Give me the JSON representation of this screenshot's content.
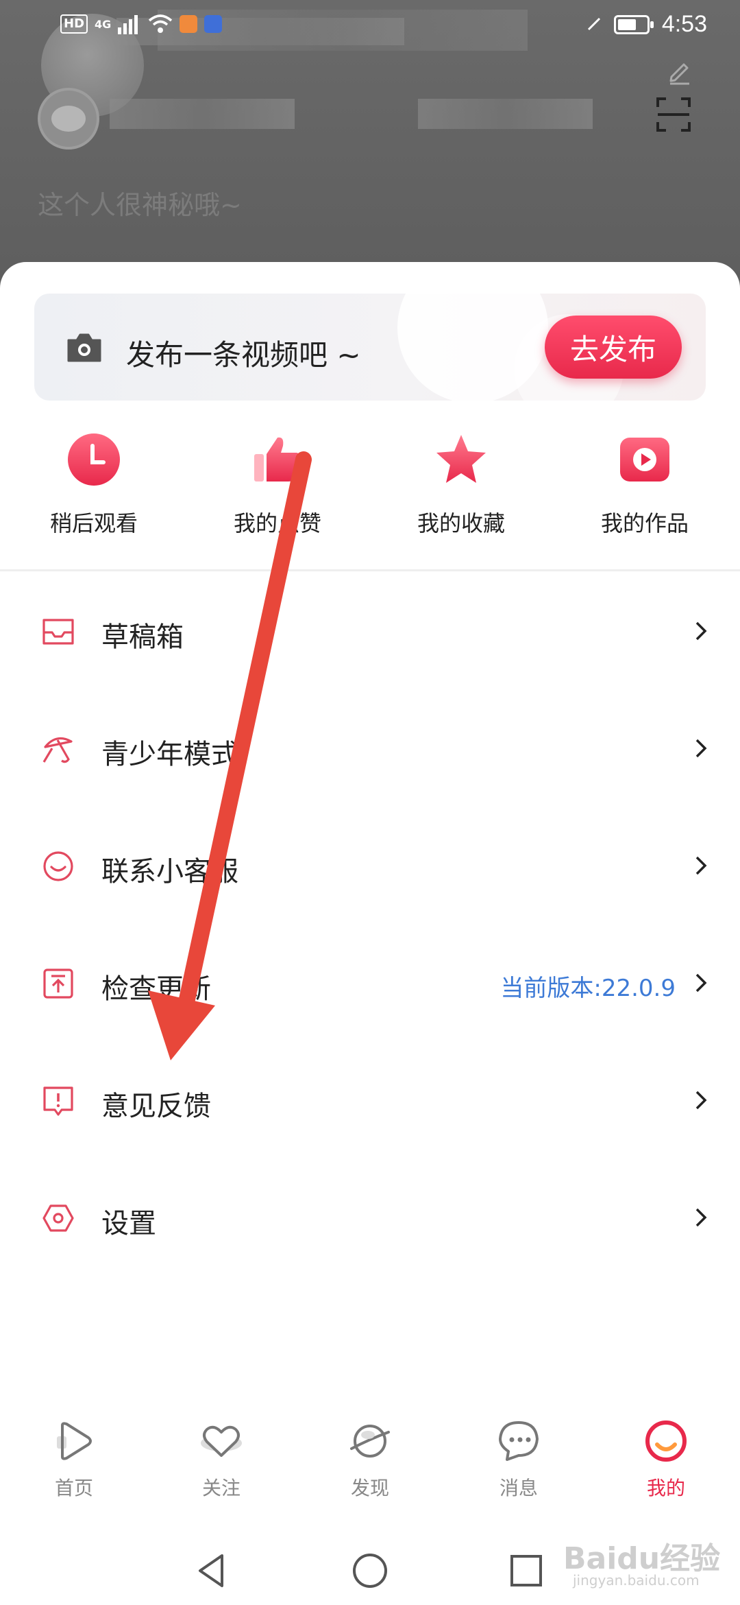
{
  "status_bar": {
    "time": "4:53",
    "hd": "HD",
    "network": "4G",
    "battery_level": 0.65
  },
  "profile": {
    "bio": "这个人很神秘哦~"
  },
  "publish": {
    "prompt": "发布一条视频吧 ~",
    "button": "去发布"
  },
  "quick_actions": [
    {
      "label": "稍后观看",
      "icon": "clock-icon"
    },
    {
      "label": "我的点赞",
      "icon": "thumbs-up-icon"
    },
    {
      "label": "我的收藏",
      "icon": "star-icon"
    },
    {
      "label": "我的作品",
      "icon": "play-icon"
    }
  ],
  "menu": [
    {
      "label": "草稿箱",
      "icon": "inbox-icon",
      "extra": ""
    },
    {
      "label": "青少年模式",
      "icon": "umbrella-icon",
      "extra": ""
    },
    {
      "label": "联系小客服",
      "icon": "smile-icon",
      "extra": ""
    },
    {
      "label": "检查更新",
      "icon": "upload-icon",
      "extra": "当前版本:22.0.9"
    },
    {
      "label": "意见反馈",
      "icon": "feedback-icon",
      "extra": ""
    },
    {
      "label": "设置",
      "icon": "hexagon-settings-icon",
      "extra": ""
    }
  ],
  "bottom_nav": [
    {
      "label": "首页",
      "icon": "play-outline-icon",
      "active": false
    },
    {
      "label": "关注",
      "icon": "heart-icon",
      "active": false
    },
    {
      "label": "发现",
      "icon": "planet-icon",
      "active": false
    },
    {
      "label": "消息",
      "icon": "chat-bubble-icon",
      "active": false
    },
    {
      "label": "我的",
      "icon": "profile-ring-icon",
      "active": true
    }
  ],
  "watermark": {
    "text": "Baidu经验",
    "sub": "jingyan.baidu.com"
  },
  "colors": {
    "accent": "#e8294b",
    "link": "#3d7ad6",
    "arrow": "#e8473a"
  }
}
